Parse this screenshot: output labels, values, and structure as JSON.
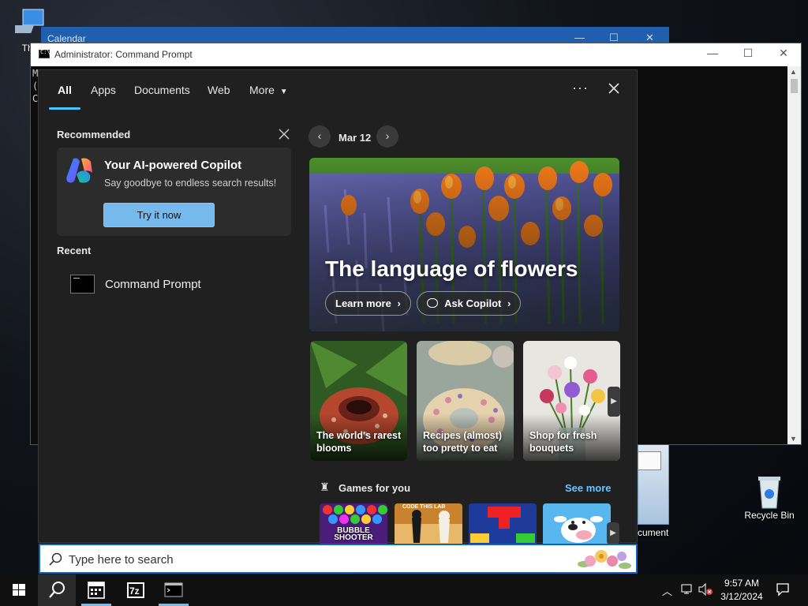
{
  "desktop": {
    "this_pc_label": "This",
    "recycle_bin_label": "Recycle Bin",
    "document_label": "cument"
  },
  "calendar_window": {
    "title": "Calendar"
  },
  "cmd_window": {
    "title": "Administrator: Command Prompt",
    "lines": [
      "M",
      "(",
      "C"
    ]
  },
  "search_panel": {
    "tabs": [
      {
        "label": "All",
        "active": true
      },
      {
        "label": "Apps"
      },
      {
        "label": "Documents"
      },
      {
        "label": "Web"
      },
      {
        "label": "More"
      }
    ],
    "recommended": {
      "title": "Recommended",
      "card_title": "Your AI-powered Copilot",
      "card_subtitle": "Say goodbye to endless search results!",
      "button_label": "Try it now"
    },
    "recent": {
      "title": "Recent",
      "items": [
        {
          "label": "Command Prompt",
          "icon": "command-prompt-icon"
        }
      ]
    },
    "highlights": {
      "date": "Mar 12",
      "hero_title": "The language of flowers",
      "learn_more": "Learn more",
      "ask_copilot": "Ask Copilot"
    },
    "cards": [
      {
        "caption": "The world's rarest blooms"
      },
      {
        "caption": "Recipes (almost) too pretty to eat"
      },
      {
        "caption": "Shop for fresh bouquets"
      }
    ],
    "games": {
      "title": "Games for you",
      "see_more": "See more",
      "tiles": [
        "BUBBLE SHOOTER",
        "CODE THIS LAB",
        "blocks",
        "cow"
      ]
    }
  },
  "searchbox": {
    "placeholder": "Type here to search"
  },
  "taskbar": {
    "time": "9:57 AM",
    "date": "3/12/2024",
    "apps": [
      "start",
      "search",
      "calendar",
      "7zip",
      "command-prompt"
    ]
  },
  "colors": {
    "accent": "#4cc2ff",
    "button": "#76b9ed",
    "link": "#6cc4ff"
  }
}
